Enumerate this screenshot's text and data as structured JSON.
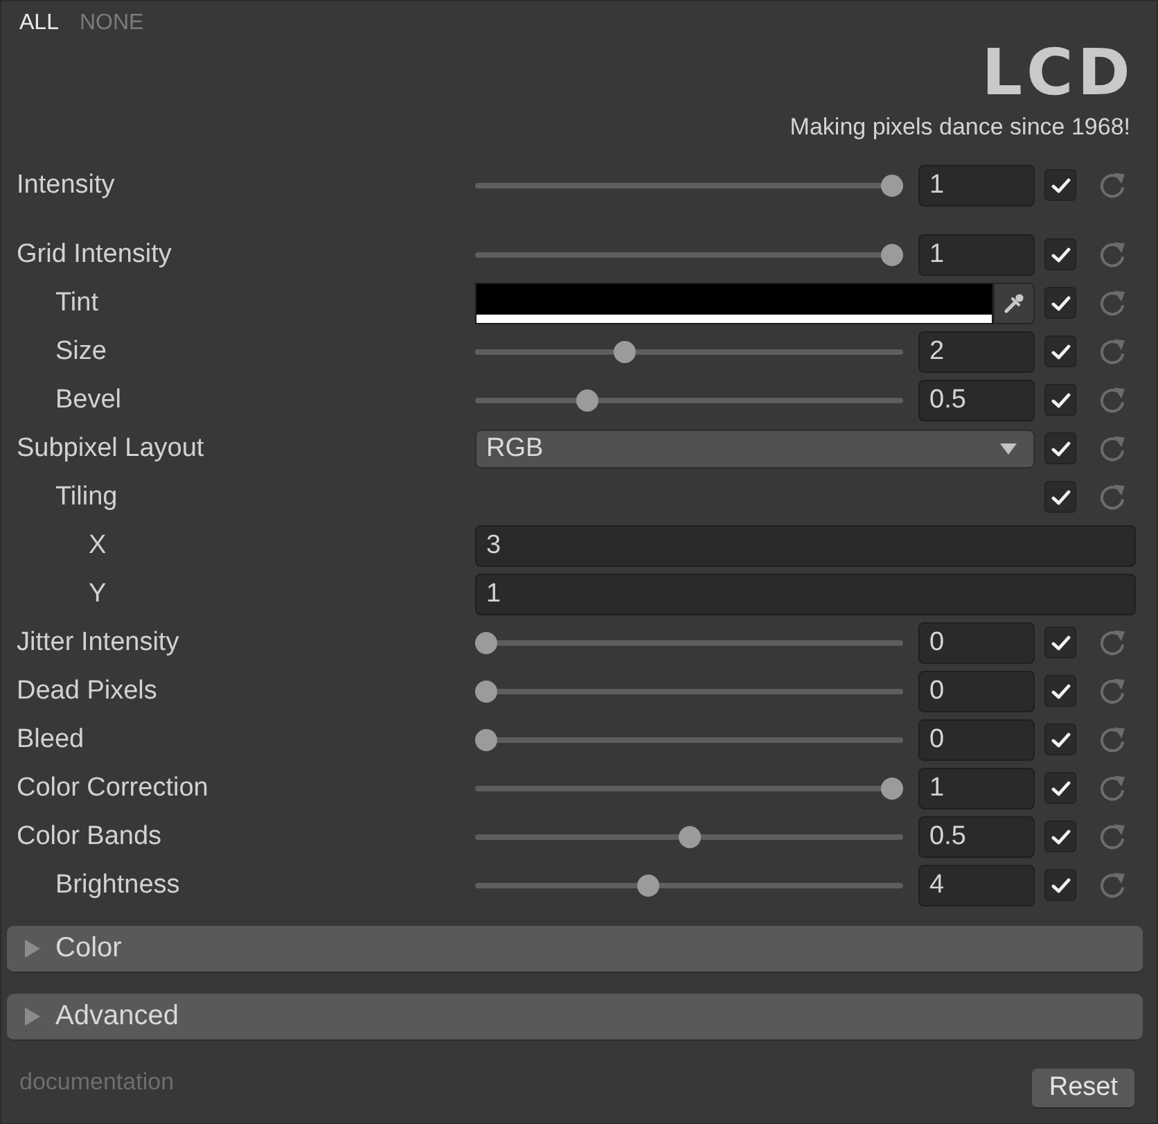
{
  "header": {
    "buttons": [
      {
        "label": "ALL",
        "selected": true
      },
      {
        "label": "NONE",
        "selected": false
      }
    ],
    "logo": "LCD",
    "tagline": "Making pixels dance since 1968!"
  },
  "intensity": {
    "kind": "slider",
    "label": "Intensity",
    "level": 1,
    "value": "1",
    "checked": true
  },
  "properties": [
    {
      "kind": "slider",
      "label": "Grid Intensity",
      "level": 1,
      "value": "1",
      "checked": true,
      "children": [
        {
          "kind": "color",
          "label": "Tint",
          "color": "#000000",
          "level": 1,
          "checked": true
        },
        {
          "kind": "slider",
          "label": "Size",
          "level": 0.34,
          "value": "2",
          "checked": true
        },
        {
          "kind": "slider",
          "label": "Bevel",
          "level": 0.25,
          "value": "0.5",
          "checked": true
        }
      ]
    },
    {
      "kind": "dropdown",
      "label": "Subpixel Layout",
      "value": "RGB",
      "checked": true,
      "children": [
        {
          "kind": "toggle",
          "label": "Tiling",
          "checked": true,
          "children": [
            {
              "kind": "field",
              "label": "X",
              "value": "3"
            },
            {
              "kind": "field",
              "label": "Y",
              "value": "1"
            }
          ]
        }
      ]
    },
    {
      "kind": "slider",
      "label": "Jitter Intensity",
      "level": 0,
      "value": "0",
      "checked": true
    },
    {
      "kind": "slider",
      "label": "Dead Pixels",
      "level": 0,
      "value": "0",
      "checked": true
    },
    {
      "kind": "slider",
      "label": "Bleed",
      "level": 0,
      "value": "0",
      "checked": true
    },
    {
      "kind": "slider",
      "label": "Color Correction",
      "level": 1,
      "value": "1",
      "checked": true
    },
    {
      "kind": "slider",
      "label": "Color Bands",
      "level": 0.5,
      "value": "0.5",
      "checked": true,
      "children": [
        {
          "kind": "slider",
          "label": "Brightness",
          "level": 0.4,
          "value": "4",
          "checked": true
        }
      ]
    }
  ],
  "sections": [
    {
      "label": "Color",
      "expanded": false
    },
    {
      "label": "Advanced",
      "expanded": false
    }
  ],
  "footer": {
    "link": "documentation",
    "button": "Reset"
  }
}
